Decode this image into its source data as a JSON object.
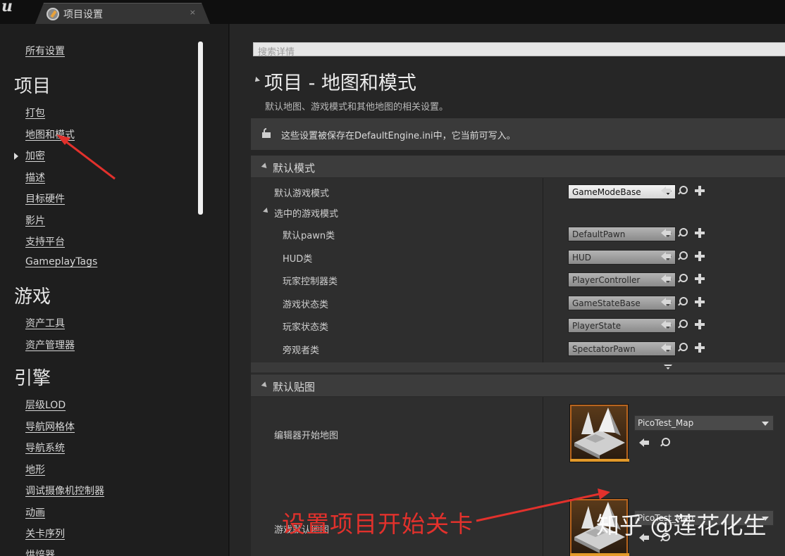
{
  "window": {
    "tab_title": "项目设置",
    "tab_close": "×",
    "logo_icon": "unreal-logo-icon",
    "tab_icon": "project-settings-icon"
  },
  "sidebar": {
    "all_settings": "所有设置",
    "sections": [
      {
        "heading": "项目",
        "items": [
          "打包",
          "地图和模式",
          "加密",
          "描述",
          "目标硬件",
          "影片",
          "支持平台",
          "GameplayTags"
        ]
      },
      {
        "heading": "游戏",
        "items": [
          "资产工具",
          "资产管理器"
        ]
      },
      {
        "heading": "引擎",
        "items": [
          "层级LOD",
          "导航网格体",
          "导航系统",
          "地形",
          "调试摄像机控制器",
          "动画",
          "关卡序列",
          "烘焙器"
        ]
      }
    ],
    "selected_item": "地图和模式"
  },
  "main": {
    "search_placeholder": "搜索详情",
    "title": "项目 - 地图和模式",
    "description": "默认地图、游戏模式和其他地图的相关设置。",
    "notice": "这些设置被保存在DefaultEngine.ini中，它当前可写入。",
    "default_modes": {
      "title": "默认模式",
      "default_game_mode_label": "默认游戏模式",
      "default_game_mode_value": "GameModeBase",
      "selected_group_label": "选中的游戏模式",
      "rows": [
        {
          "label": "默认pawn类",
          "value": "DefaultPawn"
        },
        {
          "label": "HUD类",
          "value": "HUD"
        },
        {
          "label": "玩家控制器类",
          "value": "PlayerController"
        },
        {
          "label": "游戏状态类",
          "value": "GameStateBase"
        },
        {
          "label": "玩家状态类",
          "value": "PlayerState"
        },
        {
          "label": "旁观者类",
          "value": "SpectatorPawn"
        }
      ]
    },
    "default_maps": {
      "title": "默认贴图",
      "editor_startup_label": "编辑器开始地图",
      "editor_startup_value": "PicoTest_Map",
      "game_default_label": "游戏默认地图",
      "game_default_value": "PicoTest_Map"
    }
  },
  "annotation": {
    "text": "设置项目开始关卡",
    "color": "#e2312c"
  },
  "watermark": "知乎 @莲花化生"
}
